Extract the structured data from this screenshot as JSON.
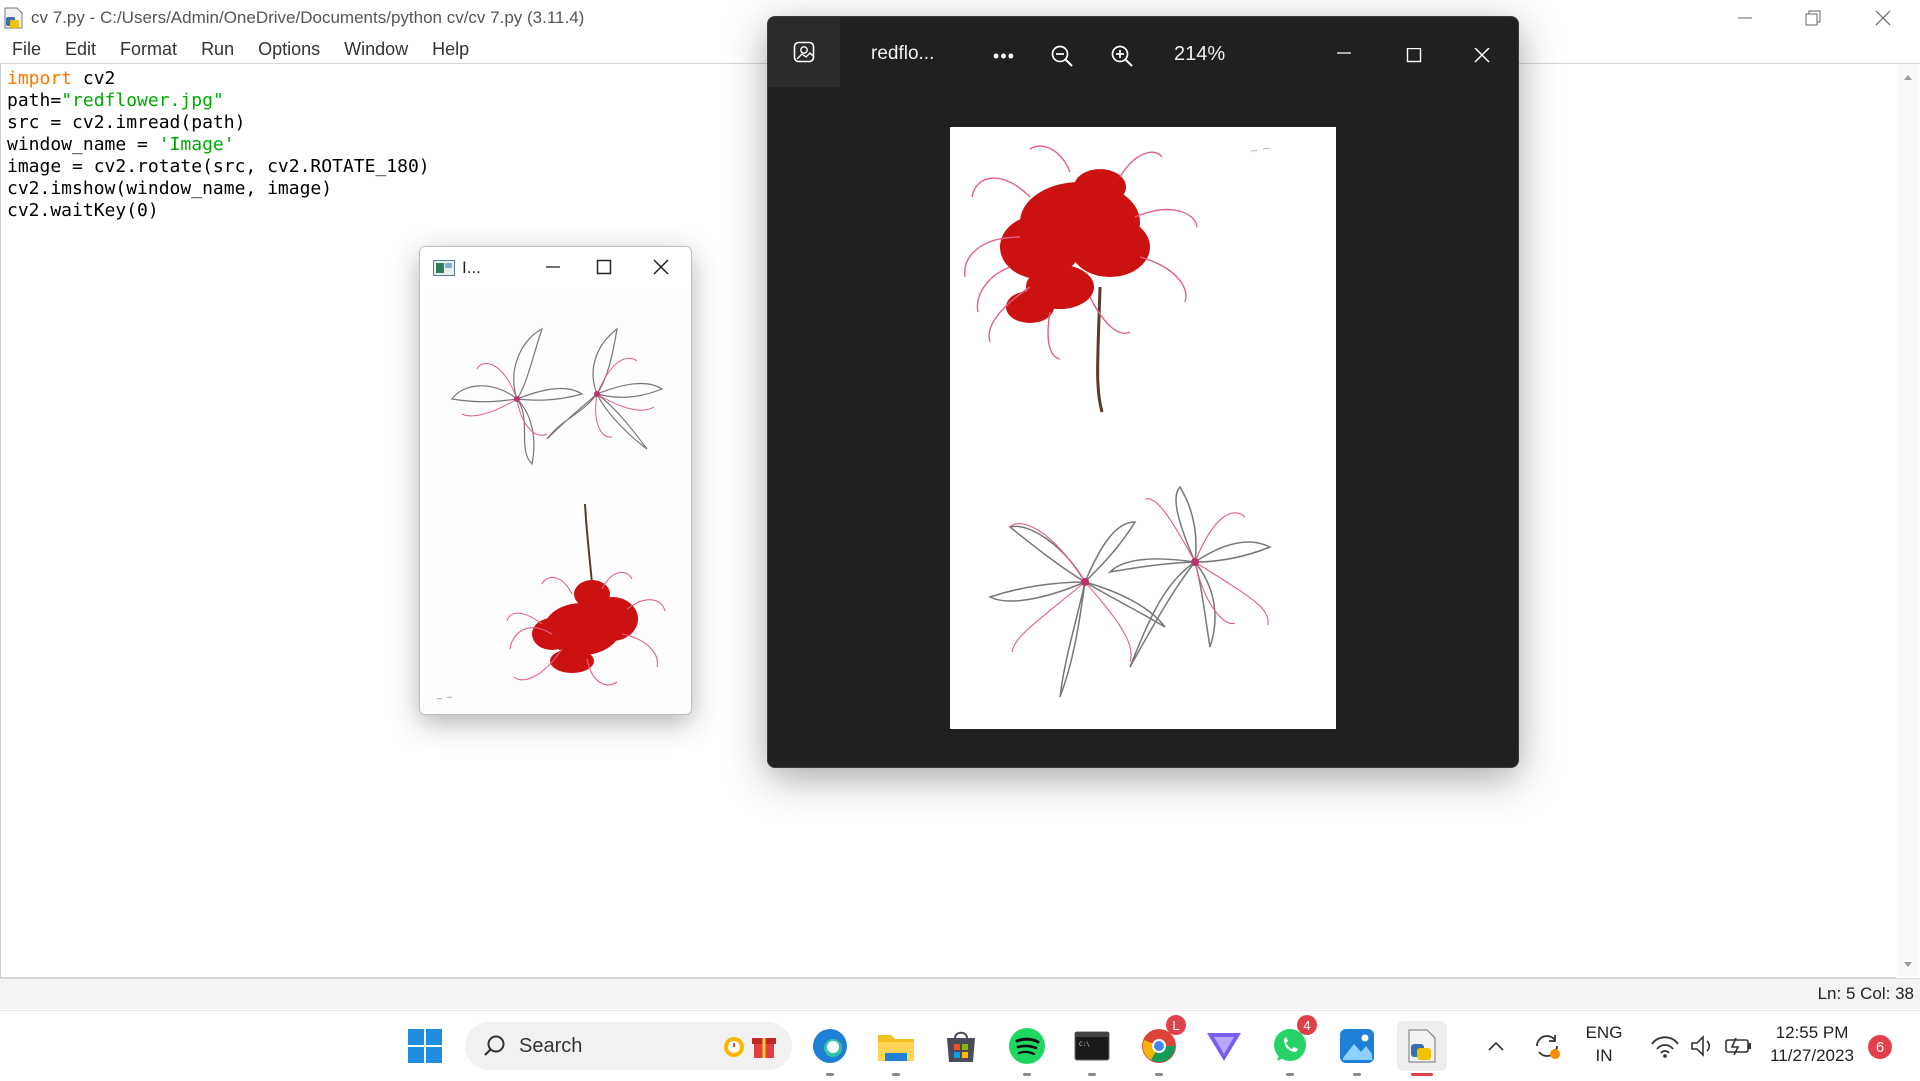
{
  "idle": {
    "title": "cv 7.py - C:/Users/Admin/OneDrive/Documents/python cv/cv 7.py (3.11.4)",
    "menu": [
      "File",
      "Edit",
      "Format",
      "Run",
      "Options",
      "Window",
      "Help"
    ],
    "code": {
      "line1_kw": "import",
      "line1_rest": " cv2",
      "line2_pre": "path=",
      "line2_str": "\"redflower.jpg\"",
      "line3": "src = cv2.imread(path)",
      "line4_pre": "window_name = ",
      "line4_str": "'Image'",
      "line5": "image = cv2.rotate(src, cv2.ROTATE_180)",
      "line6": "cv2.imshow(window_name, image)",
      "line7": "cv2.waitKey(0)"
    },
    "status": "Ln: 5   Col: 38"
  },
  "cv_window": {
    "title": "I..."
  },
  "photos": {
    "title": "redflo...",
    "more": "•••",
    "zoom": "214%"
  },
  "taskbar": {
    "search": "Search",
    "lang_top": "ENG",
    "lang_bottom": "IN",
    "time": "12:55 PM",
    "date": "11/27/2023",
    "notifications": "6",
    "whatsapp_badge": "4",
    "chrome_badge": "L"
  },
  "colors": {
    "keyword": "#ff7700",
    "string": "#00aa00",
    "photos_bg": "#202020",
    "flower_red": "#cc1111",
    "petal_pink": "#e0608c"
  }
}
